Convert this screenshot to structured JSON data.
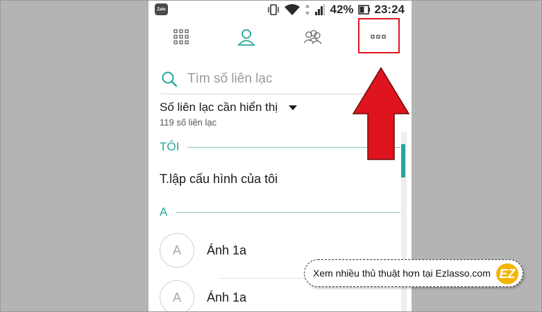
{
  "statusbar": {
    "app_badge": "Zalo",
    "battery": "42%",
    "time": "23:24"
  },
  "tabs": [
    {
      "name": "apps-grid-icon"
    },
    {
      "name": "contacts-person-icon",
      "active": true
    },
    {
      "name": "group-icon"
    },
    {
      "name": "more-dots-icon",
      "label": "···"
    }
  ],
  "search": {
    "placeholder": "Tìm số liên lạc"
  },
  "filter": {
    "title": "Số liên lạc cần hiển thị",
    "count": "119 số liên lạc"
  },
  "sections": {
    "me": "TÔI",
    "a": "A"
  },
  "my_profile": "T.lập cấu hình của tôi",
  "contacts": [
    {
      "avatar": "A",
      "name": "Ánh 1a"
    },
    {
      "avatar": "A",
      "name": "Ánh 1a"
    }
  ],
  "watermark": {
    "text": "Xem nhiều thủ thuật hơn tại Ezlasso.com",
    "logo": "EZ"
  },
  "colors": {
    "accent": "#26a69a",
    "highlight_red": "#e0141e",
    "background": "#b4b4b4"
  }
}
